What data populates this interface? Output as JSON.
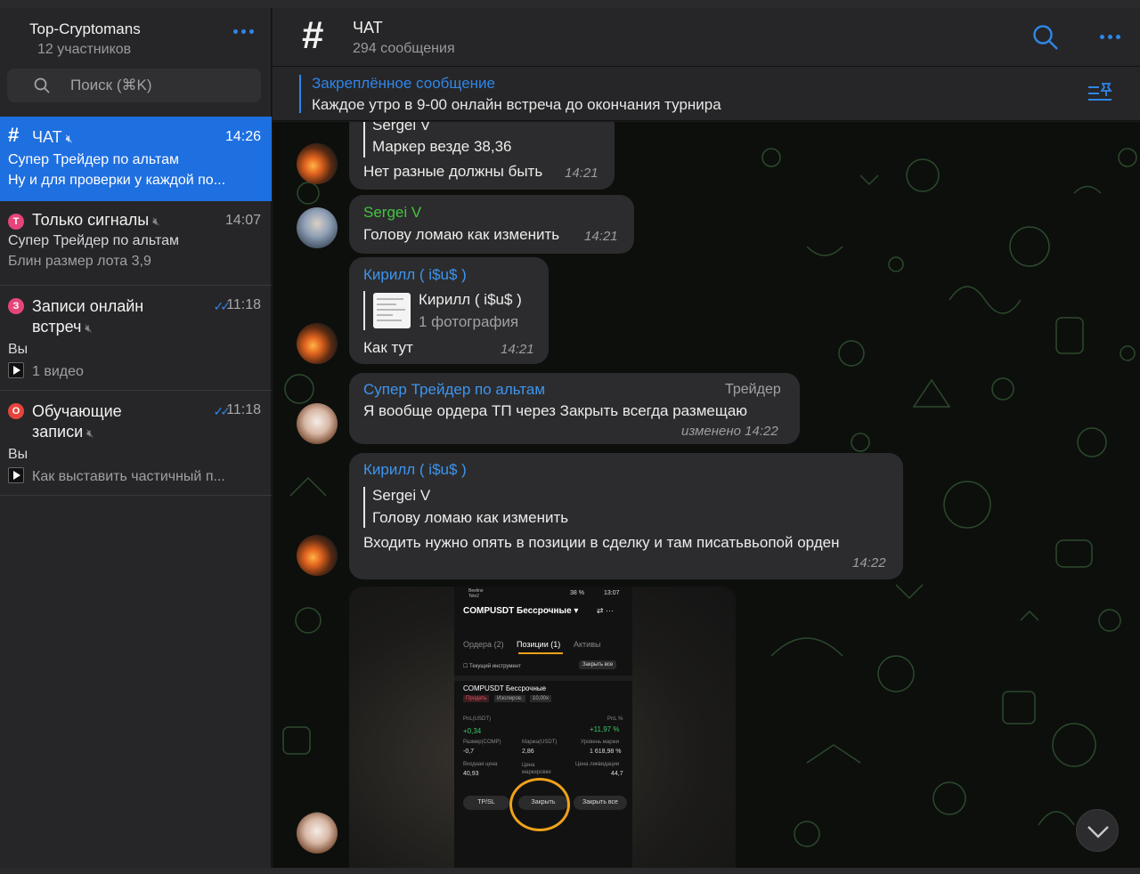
{
  "sidebar": {
    "group_title": "Top-Cryptomans",
    "group_subtitle": "12 участников",
    "search_placeholder": "Поиск (⌘K)",
    "chats": [
      {
        "title": "ЧАТ",
        "time": "14:26",
        "line1": "Супер Трейдер по альтам",
        "line2": "Ну и для проверки у каждой по..."
      },
      {
        "title": "Только сигналы",
        "badge": "T",
        "time": "14:07",
        "line1": "Супер Трейдер по альтам",
        "line2": "Блин размер лота 3,9"
      },
      {
        "title": "Записи онлайн",
        "title2": "встреч",
        "badge": "З",
        "time": "11:18",
        "line1": "Вы",
        "line2": "1 видео"
      },
      {
        "title": "Обучающие",
        "title2": "записи",
        "badge": "О",
        "time": "11:18",
        "line1": "Вы",
        "line2": "Как выставить частичный п..."
      }
    ]
  },
  "header": {
    "title": "ЧАТ",
    "subtitle": "294 сообщения"
  },
  "pinned": {
    "title": "Закреплённое сообщение",
    "text": "Каждое утро в 9-00 онлайн встреча до окончания турнира"
  },
  "messages": {
    "m1": {
      "quote_author": "Sergei V",
      "quote_text": "Маркер везде 38,36",
      "text": "Нет разные должны быть",
      "time": "14:21"
    },
    "m2": {
      "author": "Sergei V",
      "text": "Голову ломаю как изменить",
      "time": "14:21"
    },
    "m3": {
      "author": "Кирилл ( i$u$ )",
      "reply_author": "Кирилл ( i$u$ )",
      "reply_text": "1 фотография",
      "text": "Как тут",
      "time": "14:21"
    },
    "m4": {
      "author": "Супер Трейдер по альтам",
      "role": "Трейдер",
      "text": "Я вообще ордера ТП через Закрыть всегда размещаю",
      "time": "изменено 14:22"
    },
    "m5": {
      "author": "Кирилл ( i$u$ )",
      "quote_author": "Sergei V",
      "quote_text": "Голову ломаю как изменить",
      "text": "Входить нужно опять в позиции в сделку и там писатьвьопой орден",
      "time": "14:22"
    }
  },
  "phone": {
    "status_left": "Beeline Tele2",
    "status_right": "38 %",
    "status_time": "13:07",
    "pair": "COMPUSDT Бессрочные ▾",
    "tabs": [
      "Ордера (2)",
      "Позиции (1)",
      "Активы"
    ],
    "current_instrument": "Текущий инструмент",
    "close_all_small": "Закрыть все",
    "position_name": "COMPUSDT Бессрочные",
    "tag_sell": "Продать",
    "tag_isolated": "Изолиров.",
    "tag_leverage": "10,00x",
    "pnl_label": "PnL(USDT)",
    "pnl_pct_label": "PnL %",
    "pnl_value": "+0,34",
    "pnl_pct_value": "+11,97 %",
    "size_label": "Размер(COMP)",
    "margin_label": "Маржа(USDT)",
    "margin_level_label": "Уровень маржи",
    "size_value": "-0,7",
    "margin_value": "2,86",
    "margin_level_value": "1 618,98 %",
    "entry_label": "Входная цена",
    "mark_label": "Цена маркировки",
    "liq_label": "Цена ликвидации",
    "entry_value": "40,93",
    "liq_value": "44,7",
    "btn_tpsl": "TP/SL",
    "btn_close": "Закрыть",
    "btn_close_all": "Закрыть все"
  },
  "colors": {
    "accent": "#2f86e8",
    "active_chat": "#1e6fe0",
    "bubble": "#2c2c2e",
    "name_green": "#45c43f",
    "annotation": "#f0a21a"
  }
}
